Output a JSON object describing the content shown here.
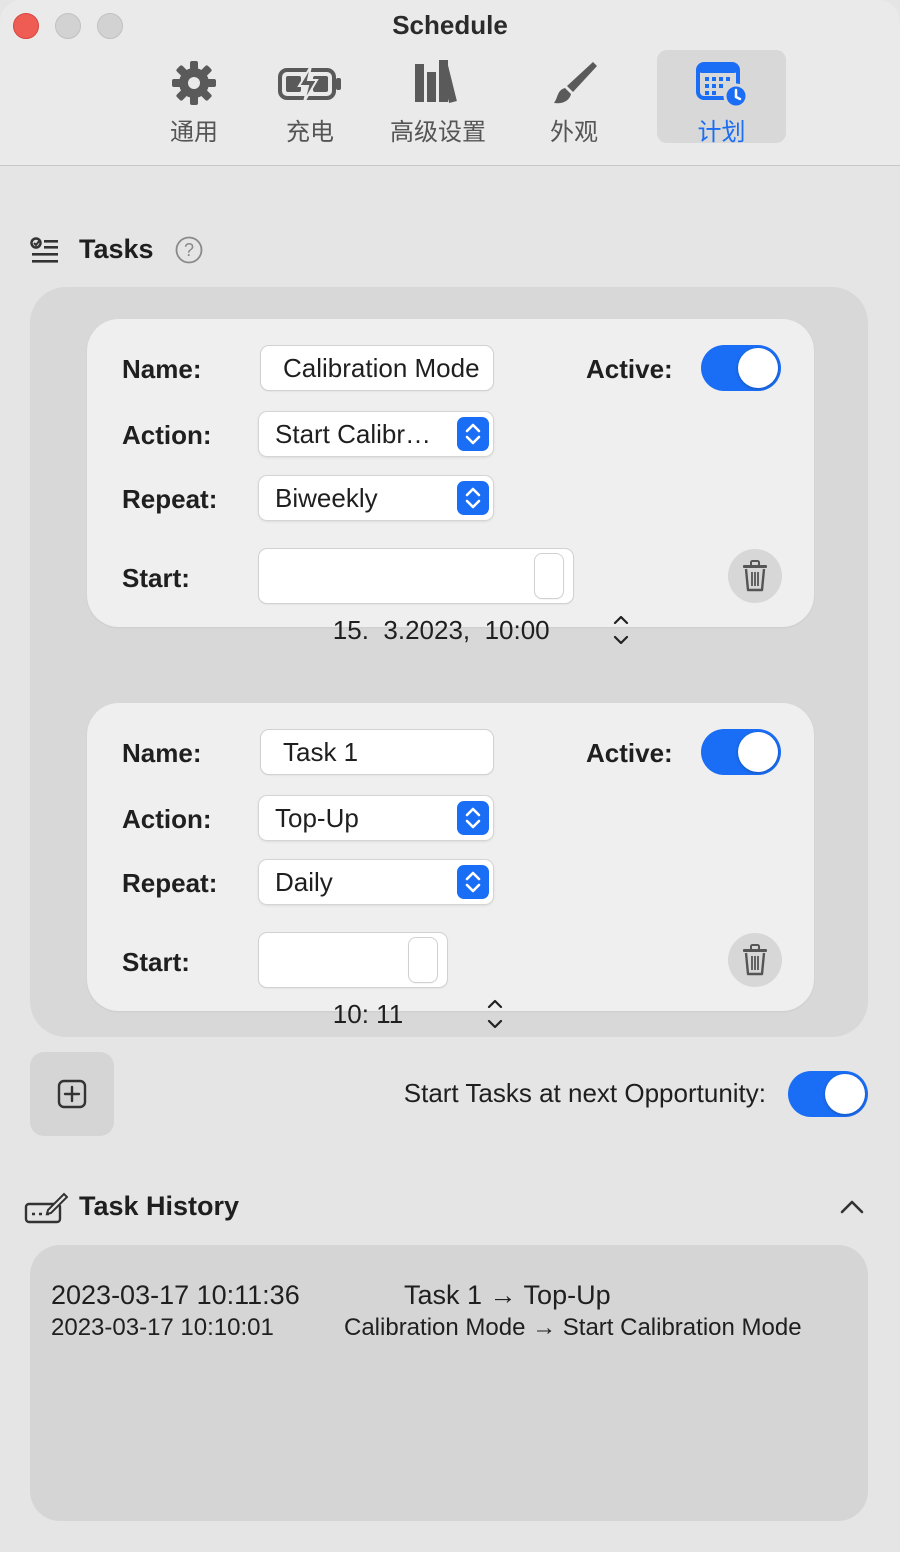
{
  "window": {
    "title": "Schedule"
  },
  "toolbar": {
    "tabs": [
      {
        "label": "通用",
        "icon": "gear-icon"
      },
      {
        "label": "充电",
        "icon": "battery-charging-icon"
      },
      {
        "label": "高级设置",
        "icon": "books-icon"
      },
      {
        "label": "外观",
        "icon": "paintbrush-icon"
      },
      {
        "label": "计划",
        "icon": "calendar-clock-icon",
        "selected": true
      }
    ]
  },
  "tasks": {
    "title": "Tasks",
    "help_icon": "question-icon",
    "items": [
      {
        "name_label": "Name:",
        "name_value": "Calibration Mode",
        "active_label": "Active:",
        "active": true,
        "action_label": "Action:",
        "action_value": "Start Calibr…",
        "repeat_label": "Repeat:",
        "repeat_value": "Biweekly",
        "start_label": "Start:",
        "start_value": "15.  3.2023,  10:00"
      },
      {
        "name_label": "Name:",
        "name_value": "Task 1",
        "active_label": "Active:",
        "active": true,
        "action_label": "Action:",
        "action_value": "Top-Up",
        "repeat_label": "Repeat:",
        "repeat_value": "Daily",
        "start_label": "Start:",
        "start_value": "10: 11"
      }
    ],
    "add_icon": "plus-square-icon",
    "opportunity_label": "Start Tasks at next Opportunity:",
    "opportunity_enabled": true
  },
  "history": {
    "title": "Task History",
    "collapse_icon": "chevron-up-icon",
    "entries": [
      {
        "time": "2023-03-17 10:11:36",
        "text": "Task 1 → Top-Up"
      },
      {
        "time": "2023-03-17 10:10:01",
        "text": "Calibration Mode → Start Calibration Mode"
      }
    ]
  },
  "colors": {
    "accent": "#1a6ef5",
    "close": "#ee5c54",
    "background": "#e6e5e5"
  }
}
